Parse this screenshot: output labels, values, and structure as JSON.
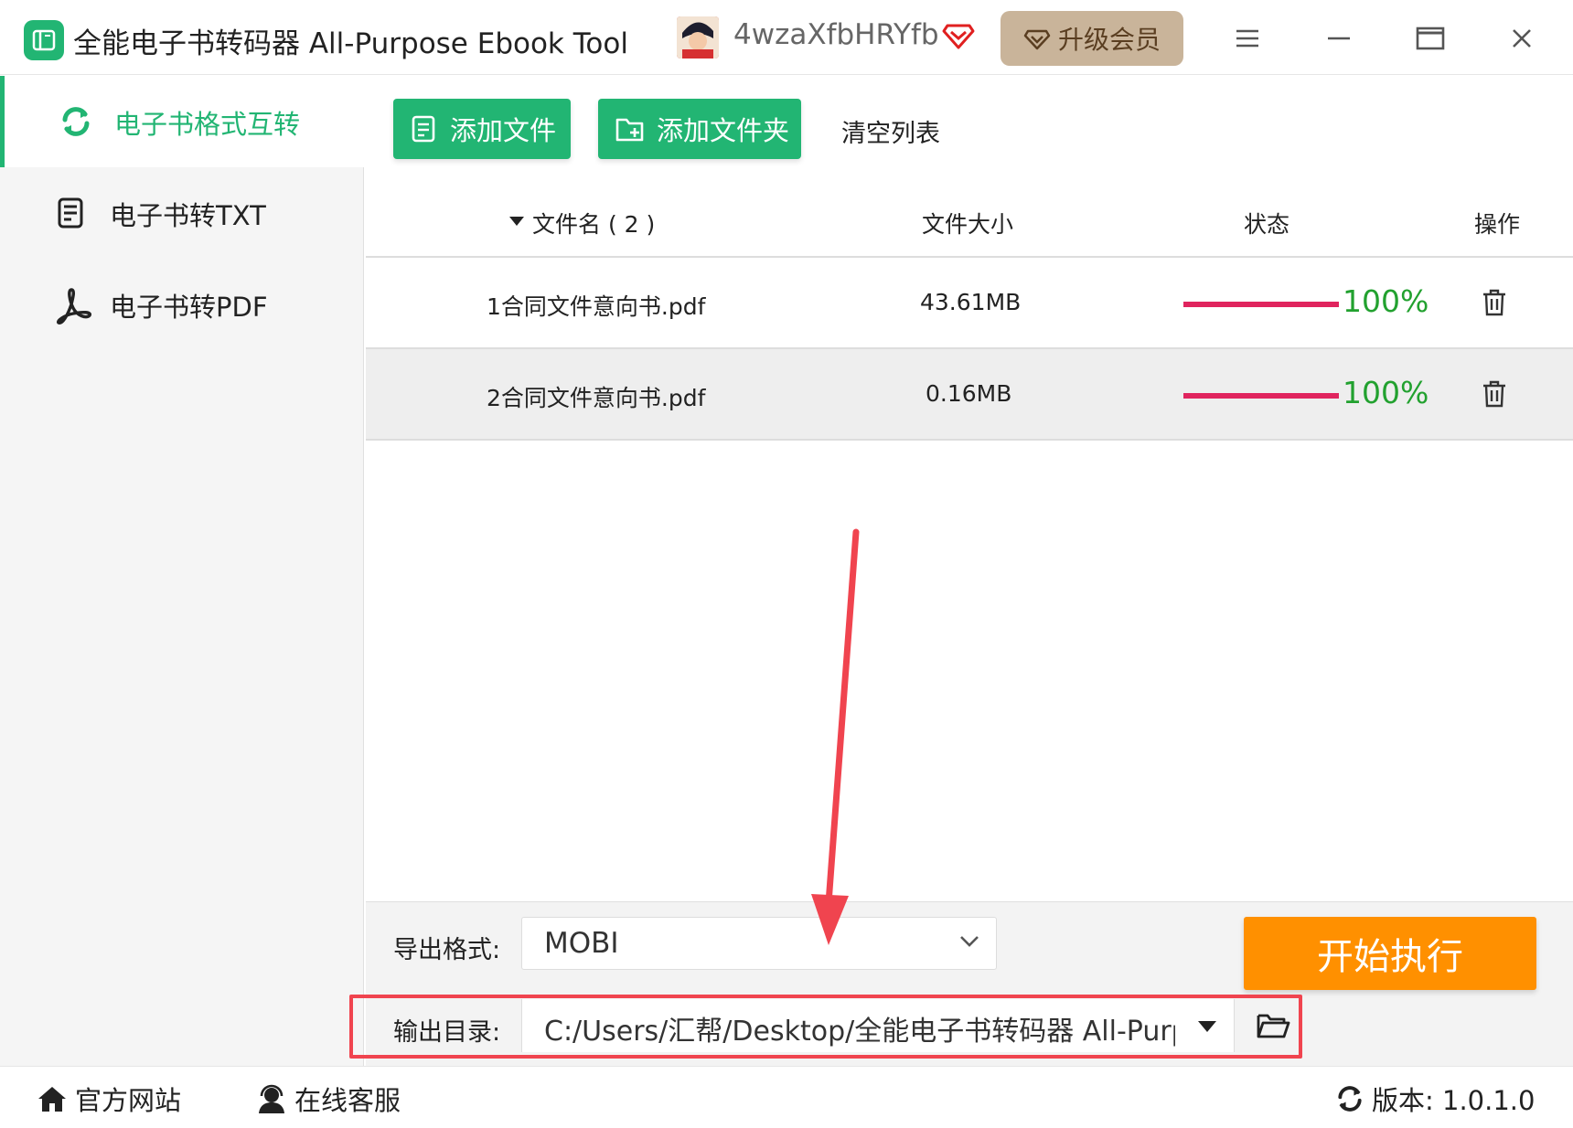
{
  "window": {
    "title": "全能电子书转码器 All-Purpose Ebook Tool",
    "username": "4wzaXfbHRYfb",
    "upgrade_label": "升级会员",
    "controls": [
      "menu-icon",
      "minimize-icon",
      "maximize-icon",
      "close-icon"
    ]
  },
  "sidebar": {
    "items": [
      {
        "label": "电子书格式互转",
        "icon": "refresh-icon",
        "active": true
      },
      {
        "label": "电子书转TXT",
        "icon": "document-icon",
        "active": false
      },
      {
        "label": "电子书转PDF",
        "icon": "pdf-icon",
        "active": false
      }
    ]
  },
  "toolbar": {
    "add_file": "添加文件",
    "add_folder": "添加文件夹",
    "clear_list": "清空列表"
  },
  "table": {
    "headers": {
      "name": "文件名 ( 2 )",
      "size": "文件大小",
      "status": "状态",
      "action": "操作"
    },
    "rows": [
      {
        "name": "1合同文件意向书.pdf",
        "size": "43.61MB",
        "progress": "100%",
        "progress_value": 1.0
      },
      {
        "name": "2合同文件意向书.pdf",
        "size": "0.16MB",
        "progress": "100%",
        "progress_value": 1.0
      }
    ]
  },
  "bottom": {
    "format_label": "导出格式:",
    "format_value": "MOBI",
    "output_label": "输出目录:",
    "output_value": "C:/Users/汇帮/Desktop/全能电子书转码器 All-Purpo:",
    "start_label": "开始执行"
  },
  "statusbar": {
    "website": "官方网站",
    "support": "在线客服",
    "version": "版本:  1.0.1.0"
  },
  "colors": {
    "accent_green": "#22b573",
    "progress_pink": "#e0245e",
    "progress_text": "#22a12f",
    "start_orange": "#ff9000",
    "annotation_red": "#f0444f",
    "upgrade_bg": "#c9b49a"
  }
}
